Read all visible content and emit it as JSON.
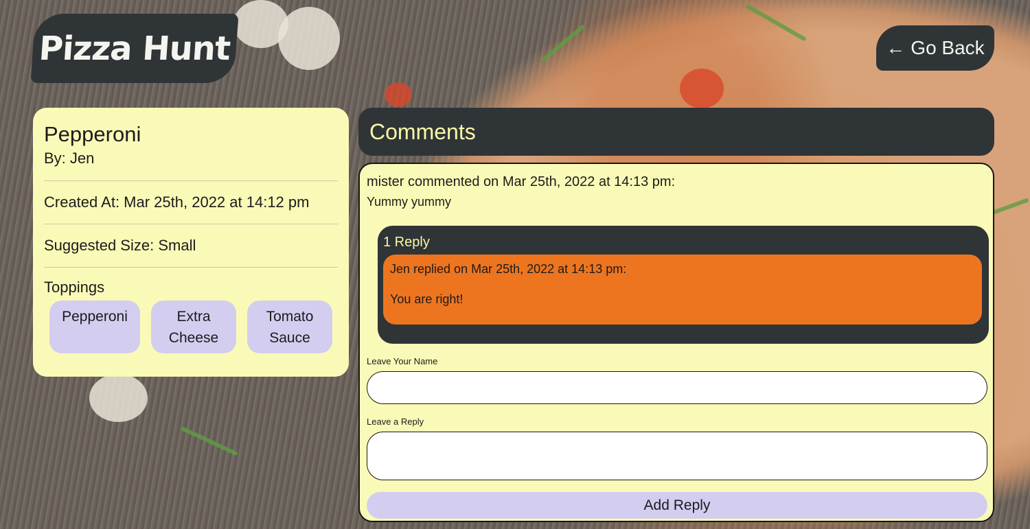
{
  "header": {
    "logo_text": "Pizza Hunt",
    "go_back_label": "Go Back",
    "go_back_icon": "arrow-left-icon"
  },
  "pizza": {
    "name": "Pepperoni",
    "by": "By: Jen",
    "created_at": "Created At: Mar 25th, 2022 at 14:12 pm",
    "suggested_size": "Suggested Size: Small",
    "toppings_title": "Toppings",
    "toppings": [
      "Pepperoni",
      "Extra Cheese",
      "Tomato Sauce"
    ]
  },
  "comments": {
    "title": "Comments",
    "items": [
      {
        "meta": "mister commented on Mar 25th, 2022 at 14:13 pm:",
        "body": "Yummy yummy",
        "replies_count": "1 Reply",
        "replies": [
          {
            "meta": "Jen replied on Mar 25th, 2022 at 14:13 pm:",
            "body": "You are right!"
          }
        ]
      }
    ]
  },
  "reply_form": {
    "name_label": "Leave Your Name",
    "name_value": "",
    "reply_label": "Leave a Reply",
    "reply_value": "",
    "submit_label": "Add Reply"
  },
  "colors": {
    "dark": "#2f3437",
    "card": "#fafab8",
    "accent_yellow": "#f9f7a8",
    "lavender": "#d3cdf0",
    "orange": "#ee751f"
  }
}
